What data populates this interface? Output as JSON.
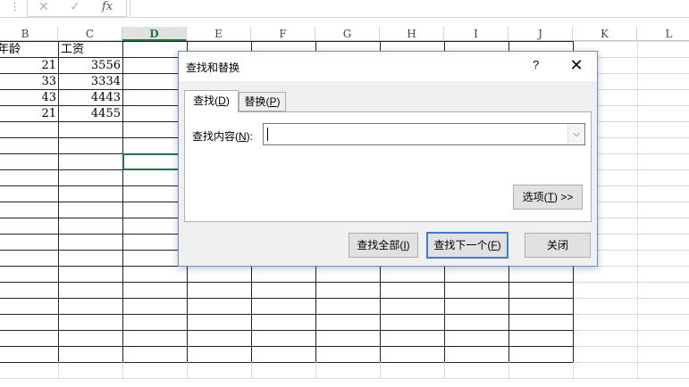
{
  "formula_bar": {
    "grip": "⋮",
    "cancel_icon": "✕",
    "enter_icon": "✓",
    "fx_label": "fx"
  },
  "columns": [
    "B",
    "C",
    "D",
    "E",
    "F",
    "G",
    "H",
    "I",
    "J",
    "K",
    "L"
  ],
  "selected_column": "D",
  "sheet": {
    "headers": [
      "年龄",
      "工资"
    ],
    "rows": [
      [
        "21",
        "3556"
      ],
      [
        "33",
        "3334"
      ],
      [
        "43",
        "4443"
      ],
      [
        "21",
        "4455"
      ]
    ]
  },
  "dialog": {
    "title": "查找和替换",
    "help": "?",
    "close": "✕",
    "tabs": [
      {
        "label": "查找(",
        "key": "D",
        "suffix": ")"
      },
      {
        "label": "替换(",
        "key": "P",
        "suffix": ")"
      }
    ],
    "find_label": "查找内容(",
    "find_key": "N",
    "find_suffix": "):",
    "find_value": "",
    "options_button": "选项(",
    "options_key": "T",
    "options_suffix": ") >>",
    "find_all_button": "查找全部(",
    "find_all_key": "I",
    "find_next_button": "查找下一个(",
    "find_next_key": "F",
    "close_button": "关闭",
    "paren_close": ")"
  }
}
